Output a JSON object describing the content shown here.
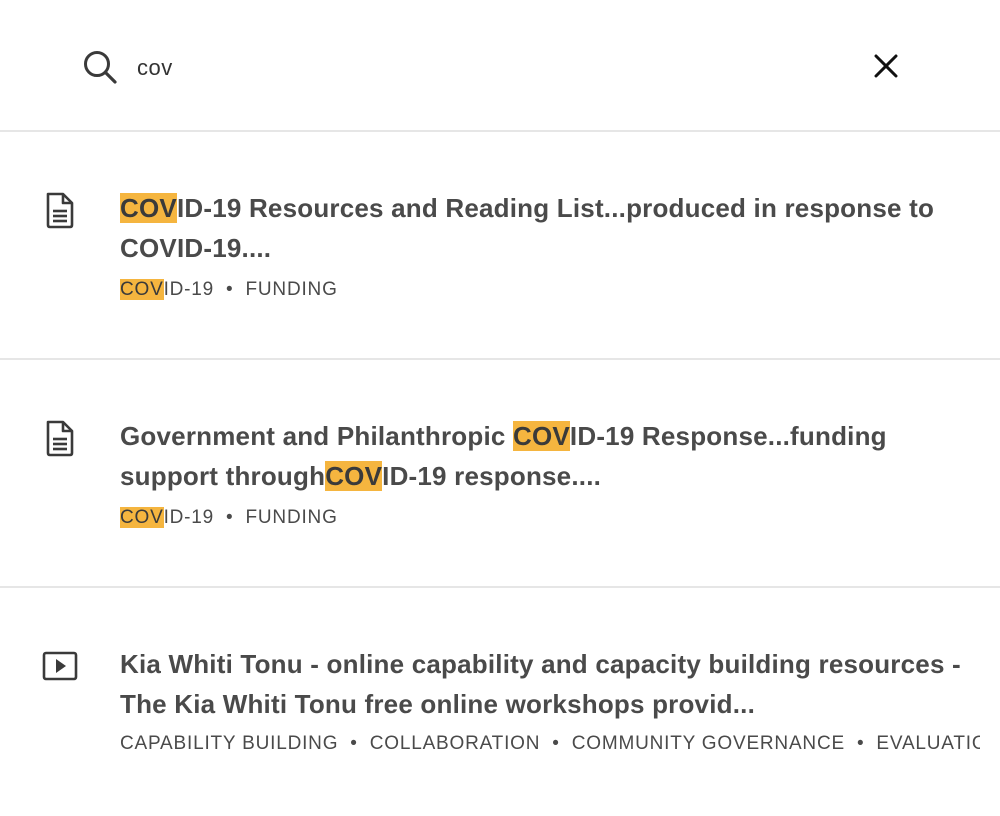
{
  "search": {
    "value": "cov",
    "placeholder": ""
  },
  "results": [
    {
      "icon": "document-icon",
      "title_hl": "COV",
      "title_1": "ID-19 Resources and Reading List...produced in response to COVID-19....",
      "tag_hl": "COV",
      "tag_1": "ID-19",
      "tag_2": "FUNDING"
    },
    {
      "icon": "document-icon",
      "title_pre": "Government and Philanthropic ",
      "title_hl": "COV",
      "title_1": "ID-19 Response...funding support through",
      "title_hl2": "COV",
      "title_2": "ID-19 response....",
      "tag_hl": "COV",
      "tag_1": "ID-19",
      "tag_2": "FUNDING"
    },
    {
      "icon": "video-play-icon",
      "title": "Kia Whiti Tonu - online capability and capacity building resources - The Kia Whiti Tonu free online workshops provid...",
      "tags": [
        "CAPABILITY BUILDING",
        "COLLABORATION",
        "COMMUNITY GOVERNANCE",
        "EVALUATION"
      ]
    }
  ],
  "colors": {
    "highlight": "#f5b53f",
    "text": "#4a4a4a",
    "divider": "#e6e6e6"
  }
}
